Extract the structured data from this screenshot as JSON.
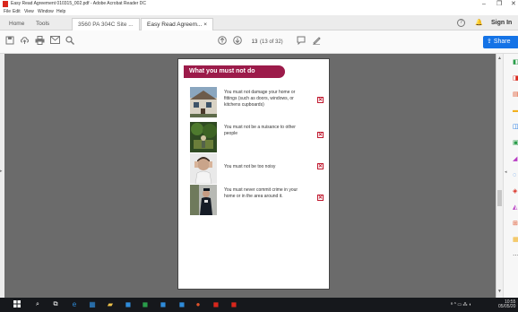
{
  "window": {
    "title": "Easy Read Agreement 010315_002.pdf - Adobe Acrobat Reader DC",
    "minimize": "–",
    "restore": "❐",
    "close": "✕"
  },
  "menu": [
    "File",
    "Edit",
    "View",
    "Window",
    "Help"
  ],
  "tabs": {
    "home": "Home",
    "tools": "Tools",
    "doc1": "3560 PA 304C Site ...",
    "doc2": "Easy Read Agreem... ×"
  },
  "header_right": {
    "help": "?",
    "bell": "🔔",
    "signin": "Sign In"
  },
  "toolbar": {
    "page_current": "13",
    "page_count": "(13 of 32)",
    "share": "Share"
  },
  "page": {
    "heading": "What you must not do",
    "rows": [
      {
        "text": "You must not damage your home or fittings (such as doors, windows, or kitchens cupboards)",
        "photo": "house-photo"
      },
      {
        "text": "You must not be a nuisance to other people",
        "photo": "garden-photo"
      },
      {
        "text": "You must not be too noisy",
        "photo": "person-covering-ears-photo"
      },
      {
        "text": "You must never commit crime in your home or in the area around it.",
        "photo": "police-photo"
      }
    ],
    "number": "13"
  },
  "colors": {
    "accent": "#9c1b4a",
    "share": "#1473e6",
    "cross": "#c0182e"
  },
  "tray": {
    "time": "10:55",
    "date": "05/05/20"
  }
}
